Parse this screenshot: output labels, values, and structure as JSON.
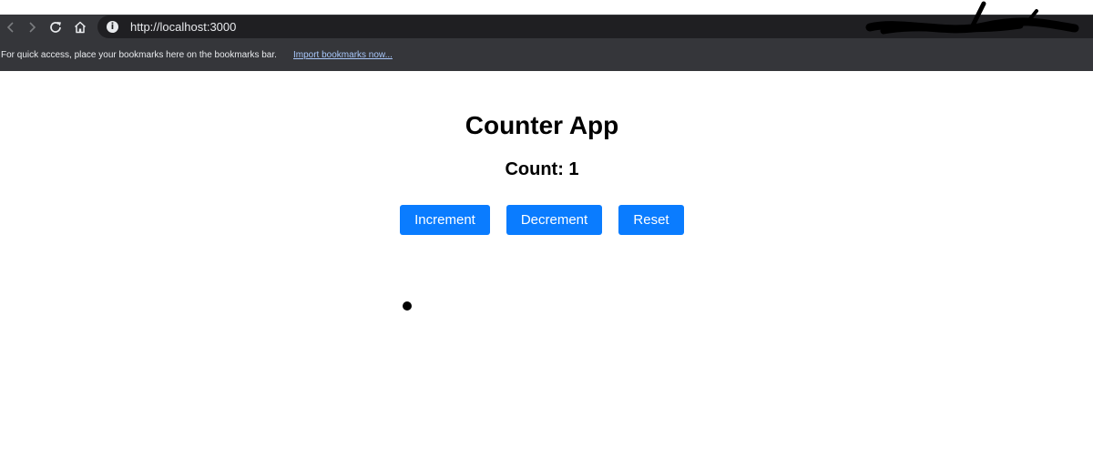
{
  "browser": {
    "url": "http://localhost:3000",
    "bookmarks_bar": {
      "message": "For quick access, place your bookmarks here on the bookmarks bar.",
      "link": "Import bookmarks now..."
    },
    "icons": [
      "back-icon",
      "forward-icon",
      "reload-icon",
      "home-icon",
      "info-icon"
    ],
    "colors": {
      "toolbar": "#35363a",
      "omnibox": "#1f1f22",
      "link": "#a8c7fa"
    }
  },
  "app": {
    "title": "Counter App",
    "count_label": "Count: 1",
    "buttons": {
      "increment": "Increment",
      "decrement": "Decrement",
      "reset": "Reset"
    },
    "colors": {
      "button": "#0a7cff",
      "button_text": "#ffffff"
    }
  }
}
